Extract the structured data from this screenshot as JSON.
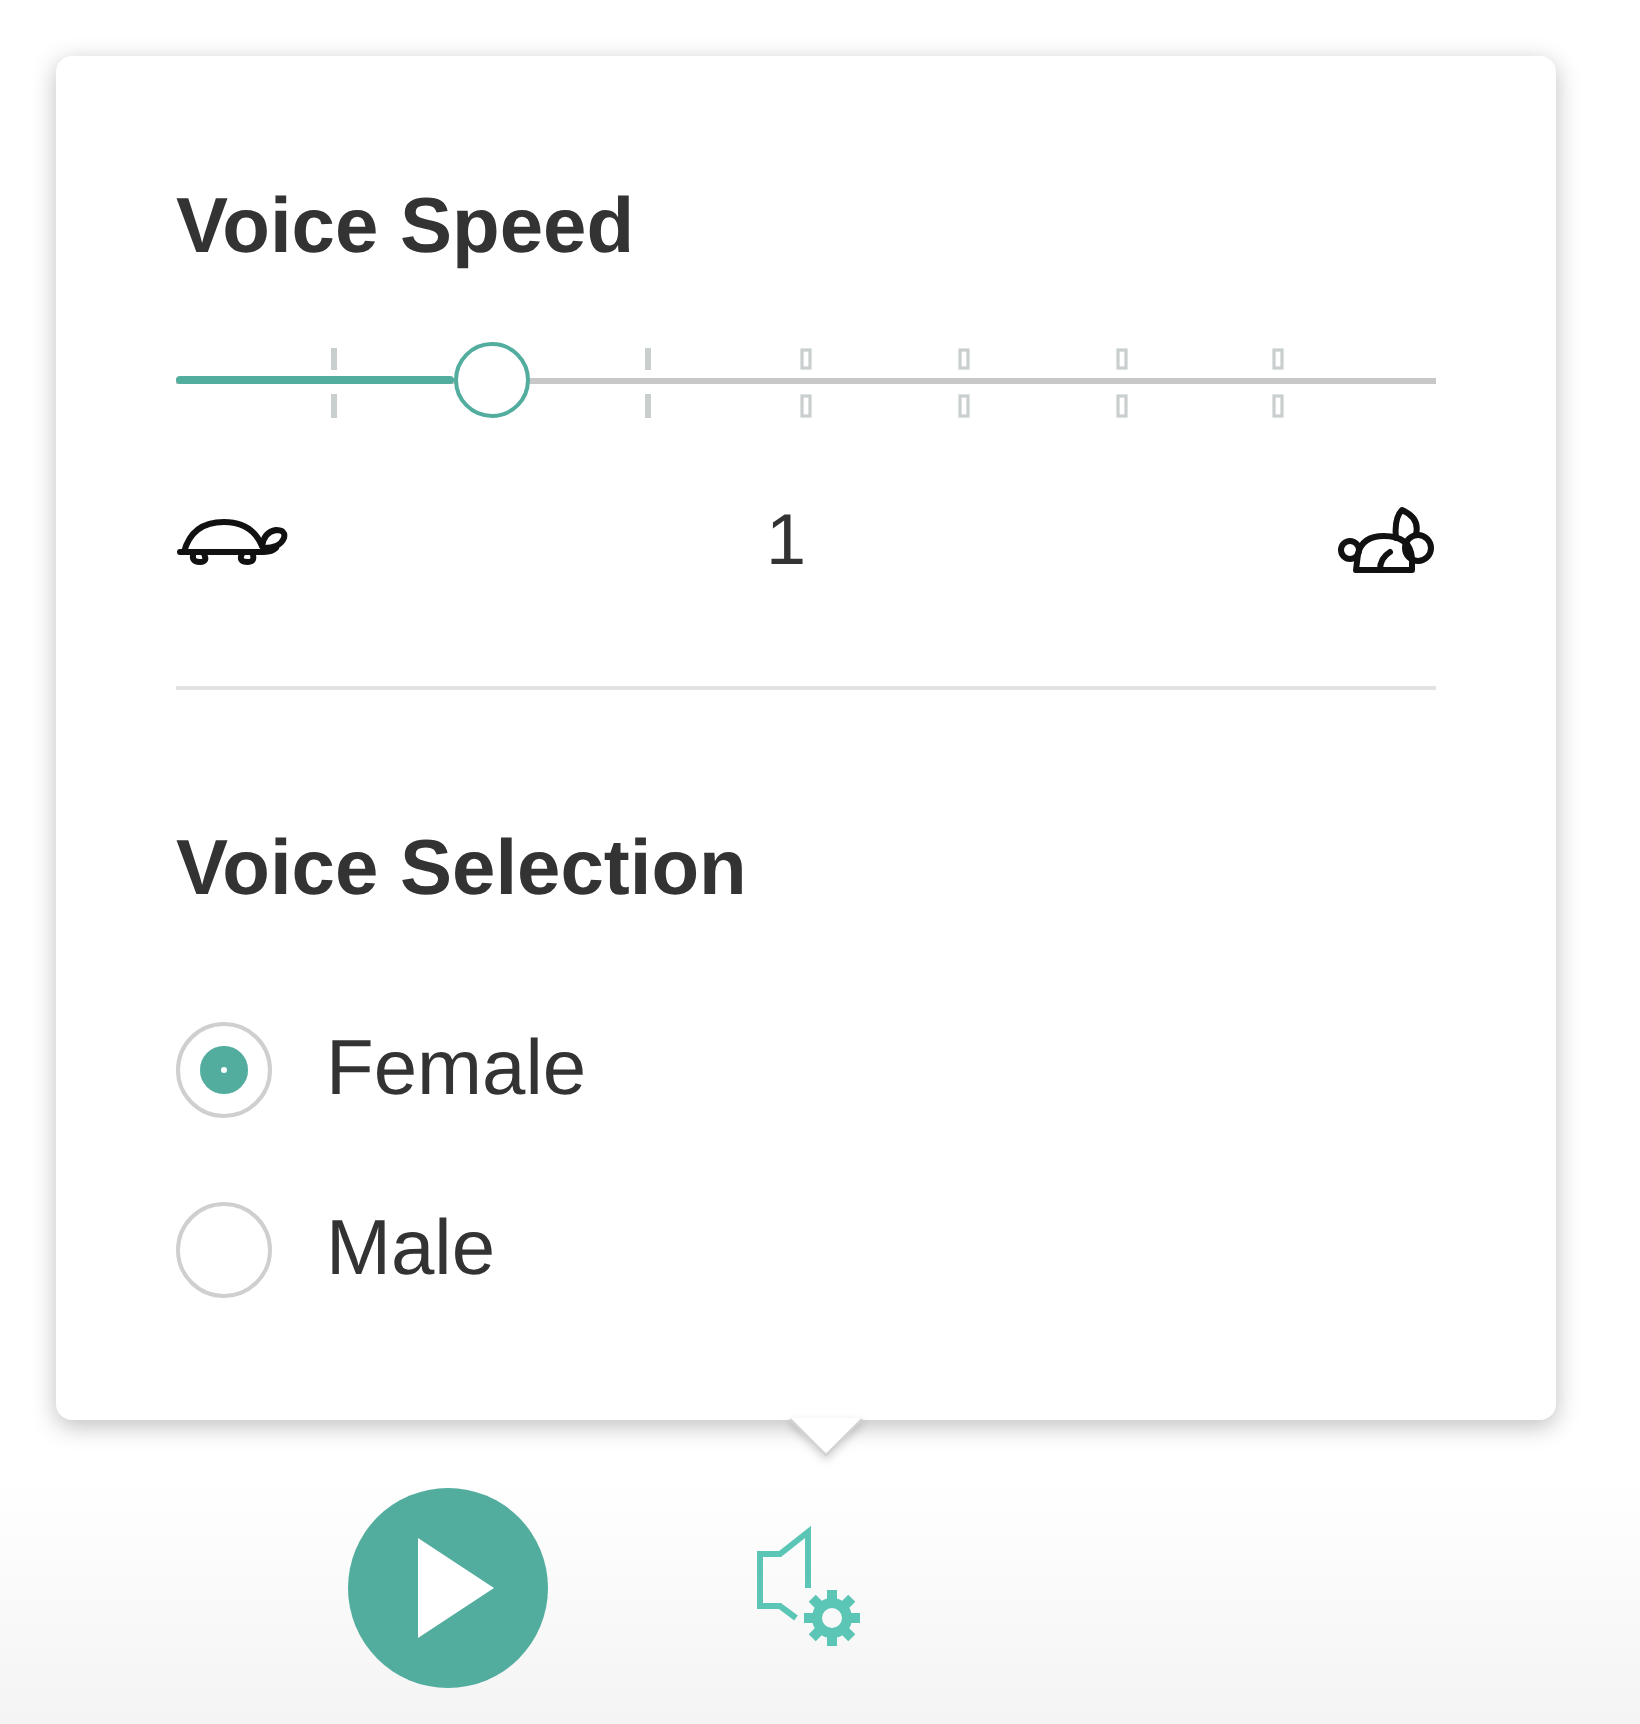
{
  "voice_speed": {
    "title": "Voice Speed",
    "slider": {
      "level": 0.25,
      "ticks": [
        {
          "kind": "solid"
        },
        {
          "kind": "solid"
        },
        {
          "kind": "hollow"
        },
        {
          "kind": "hollow"
        },
        {
          "kind": "hollow"
        },
        {
          "kind": "hollow"
        }
      ]
    },
    "value": "1"
  },
  "voice_selection": {
    "title": "Voice Selection",
    "options": [
      {
        "label": "Female",
        "selected": true
      },
      {
        "label": "Male",
        "selected": false
      }
    ]
  }
}
